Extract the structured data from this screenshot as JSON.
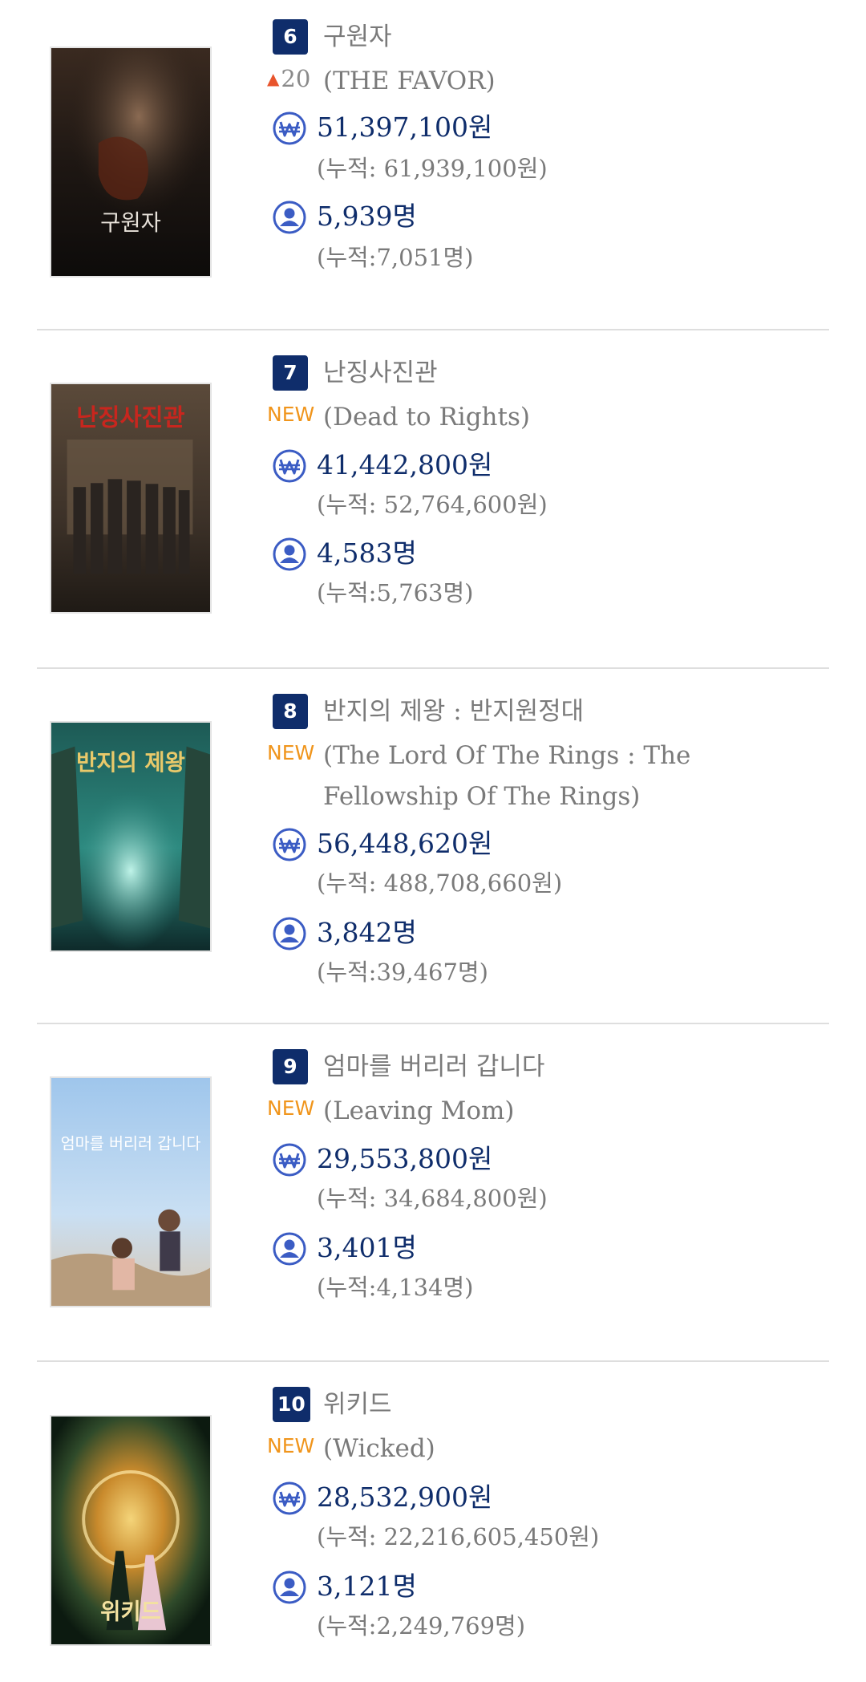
{
  "movies": [
    {
      "rank": "6",
      "title_ko": "구원자",
      "change_type": "up",
      "change_label": "20",
      "title_en": "(THE FAVOR)",
      "revenue": "51,397,100원",
      "revenue_cumulative": "(누적: 61,939,100원)",
      "audience": "5,939명",
      "audience_cumulative": "(누적:7,051명)",
      "poster": {
        "icon": "poster-image",
        "text": "구원자"
      }
    },
    {
      "rank": "7",
      "title_ko": "난징사진관",
      "change_type": "new",
      "change_label": "NEW",
      "title_en": "(Dead to Rights)",
      "revenue": "41,442,800원",
      "revenue_cumulative": "(누적: 52,764,600원)",
      "audience": "4,583명",
      "audience_cumulative": "(누적:5,763명)",
      "poster": {
        "icon": "poster-image",
        "text": "난징사진관"
      }
    },
    {
      "rank": "8",
      "title_ko": "반지의 제왕 : 반지원정대",
      "change_type": "new",
      "change_label": "NEW",
      "title_en": "(The Lord Of The Rings : The Fellowship Of The Rings)",
      "revenue": "56,448,620원",
      "revenue_cumulative": "(누적: 488,708,660원)",
      "audience": "3,842명",
      "audience_cumulative": "(누적:39,467명)",
      "poster": {
        "icon": "poster-image",
        "text": "반지의 제왕"
      }
    },
    {
      "rank": "9",
      "title_ko": "엄마를 버리러 갑니다",
      "change_type": "new",
      "change_label": "NEW",
      "title_en": "(Leaving Mom)",
      "revenue": "29,553,800원",
      "revenue_cumulative": "(누적: 34,684,800원)",
      "audience": "3,401명",
      "audience_cumulative": "(누적:4,134명)",
      "poster": {
        "icon": "poster-image",
        "text": "엄마를 버리러 갑니다"
      }
    },
    {
      "rank": "10",
      "title_ko": "위키드",
      "change_type": "new",
      "change_label": "NEW",
      "title_en": "(Wicked)",
      "revenue": "28,532,900원",
      "revenue_cumulative": "(누적: 22,216,605,450원)",
      "audience": "3,121명",
      "audience_cumulative": "(누적:2,249,769명)",
      "poster": {
        "icon": "poster-image",
        "text": "위키드"
      }
    }
  ],
  "icons": {
    "revenue": "won-coin-icon",
    "audience": "person-icon",
    "up": "arrow-up-icon"
  },
  "colors": {
    "rank_badge": "#0f2d6b",
    "metric": "#0f2d6b",
    "new_badge": "#f0951c",
    "icon_blue": "#3b5cc4",
    "up_arrow": "#e8542c"
  }
}
